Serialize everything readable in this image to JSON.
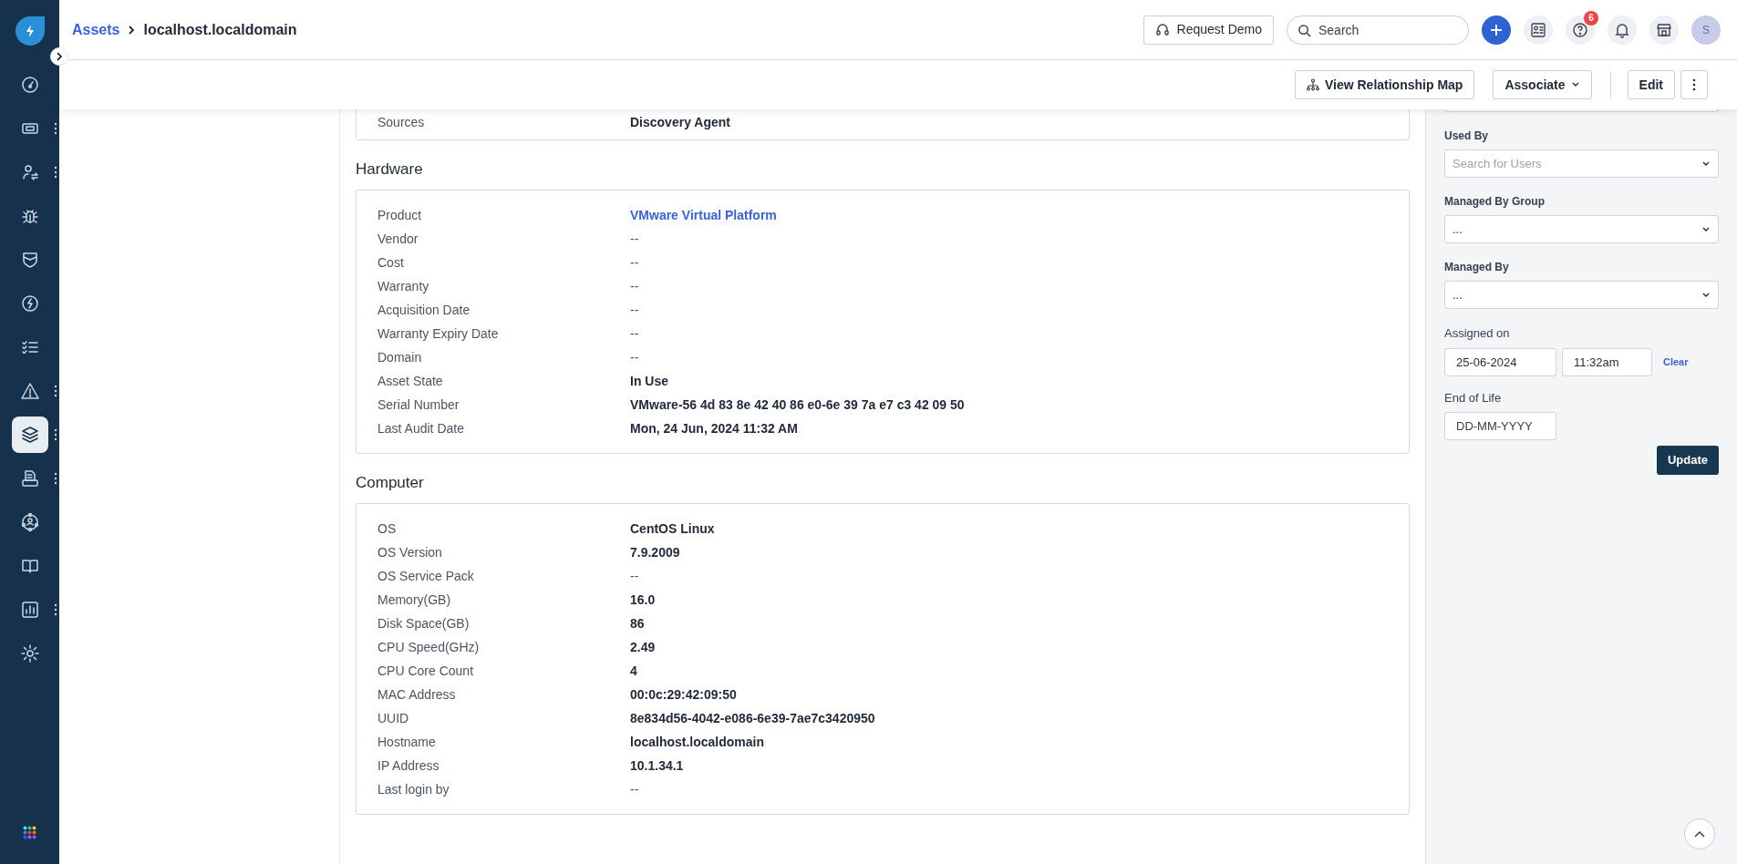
{
  "sidebar": {
    "items": [
      {
        "selected": false,
        "has_menu": false
      },
      {
        "selected": false,
        "has_menu": true
      },
      {
        "selected": false,
        "has_menu": true
      },
      {
        "selected": false,
        "has_menu": false
      },
      {
        "selected": false,
        "has_menu": false
      },
      {
        "selected": false,
        "has_menu": false
      },
      {
        "selected": false,
        "has_menu": false
      },
      {
        "selected": false,
        "has_menu": true
      },
      {
        "selected": true,
        "has_menu": true
      },
      {
        "selected": false,
        "has_menu": true
      },
      {
        "selected": false,
        "has_menu": false
      },
      {
        "selected": false,
        "has_menu": false
      },
      {
        "selected": false,
        "has_menu": true
      },
      {
        "selected": false,
        "has_menu": false
      }
    ]
  },
  "breadcrumb": {
    "parent": "Assets",
    "current": "localhost.localdomain"
  },
  "header": {
    "request_demo": "Request Demo",
    "search": {
      "placeholder": "Search"
    },
    "help_badge": "6",
    "avatar": "S"
  },
  "toolbar": {
    "buttons": [
      "View Relationship Map",
      "Associate",
      "Edit"
    ]
  },
  "sections": [
    {
      "rows": [
        {
          "label": "Sources",
          "value": "Discovery Agent",
          "kind": "bold"
        }
      ]
    },
    {
      "title": "Hardware",
      "rows": [
        {
          "label": "Product",
          "value": "VMware Virtual Platform",
          "kind": "link"
        },
        {
          "label": "Vendor",
          "value": "--",
          "kind": "plain"
        },
        {
          "label": "Cost",
          "value": "--",
          "kind": "plain"
        },
        {
          "label": "Warranty",
          "value": "--",
          "kind": "plain"
        },
        {
          "label": "Acquisition Date",
          "value": "--",
          "kind": "plain"
        },
        {
          "label": "Warranty Expiry Date",
          "value": "--",
          "kind": "plain"
        },
        {
          "label": "Domain",
          "value": "--",
          "kind": "plain"
        },
        {
          "label": "Asset State",
          "value": "In Use",
          "kind": "bold"
        },
        {
          "label": "Serial Number",
          "value": "VMware-56 4d 83 8e 42 40 86 e0-6e 39 7a e7 c3 42 09 50",
          "kind": "bold"
        },
        {
          "label": "Last Audit Date",
          "value": "Mon, 24 Jun, 2024 11:32 AM",
          "kind": "bold"
        }
      ]
    },
    {
      "title": "Computer",
      "rows": [
        {
          "label": "OS",
          "value": "CentOS Linux",
          "kind": "bold"
        },
        {
          "label": "OS Version",
          "value": "7.9.2009",
          "kind": "bold"
        },
        {
          "label": "OS Service Pack",
          "value": "--",
          "kind": "plain"
        },
        {
          "label": "Memory(GB)",
          "value": "16.0",
          "kind": "bold"
        },
        {
          "label": "Disk Space(GB)",
          "value": "86",
          "kind": "bold"
        },
        {
          "label": "CPU Speed(GHz)",
          "value": "2.49",
          "kind": "bold"
        },
        {
          "label": "CPU Core Count",
          "value": "4",
          "kind": "bold"
        },
        {
          "label": "MAC Address",
          "value": "00:0c:29:42:09:50",
          "kind": "bold"
        },
        {
          "label": "UUID",
          "value": "8e834d56-4042-e086-6e39-7ae7c3420950",
          "kind": "bold"
        },
        {
          "label": "Hostname",
          "value": "localhost.localdomain",
          "kind": "bold"
        },
        {
          "label": "IP Address",
          "value": "10.1.34.1",
          "kind": "bold"
        },
        {
          "label": "Last login by",
          "value": "--",
          "kind": "plain"
        }
      ]
    }
  ],
  "side_panel": {
    "fields": [
      {
        "label": "Used By",
        "placeholder": "Search for Users",
        "kind": "select"
      },
      {
        "label": "Managed By Group",
        "value": "...",
        "kind": "select"
      },
      {
        "label": "Managed By",
        "value": "...",
        "kind": "select"
      }
    ],
    "assigned_on": {
      "label": "Assigned on",
      "date": "25-06-2024",
      "time": "11:32am",
      "clear": "Clear"
    },
    "end_of_life": {
      "label": "End of Life",
      "placeholder": "DD-MM-YYYY"
    },
    "update": "Update"
  }
}
